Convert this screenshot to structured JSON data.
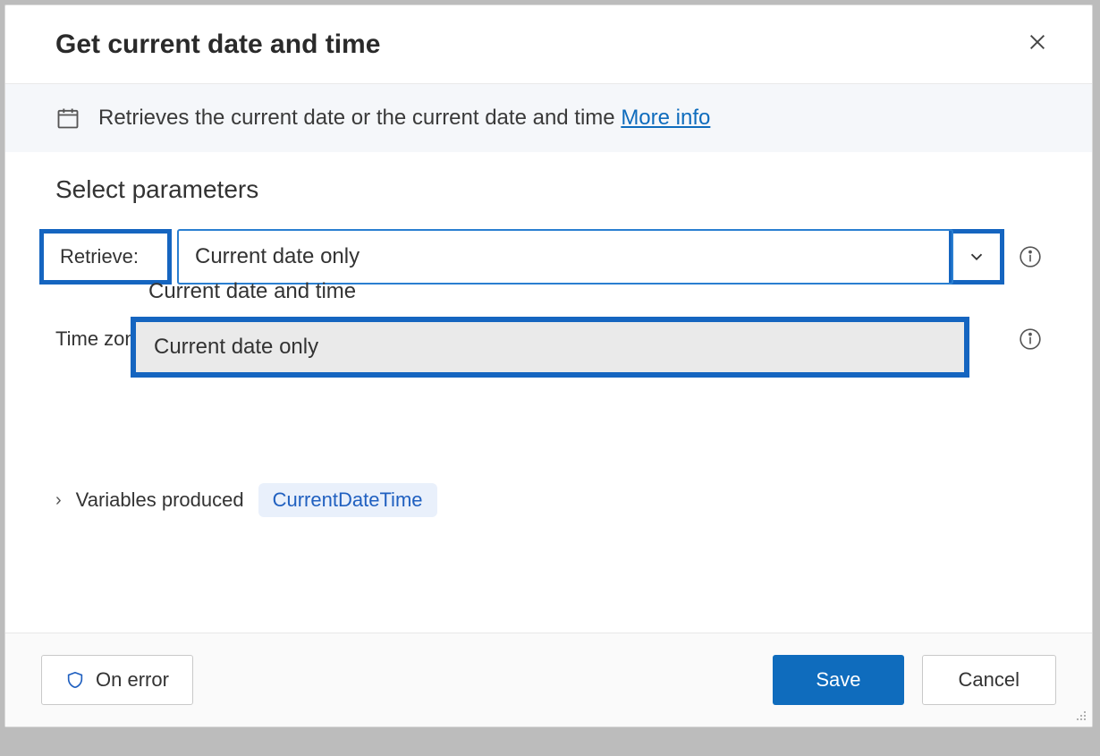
{
  "dialog": {
    "title": "Get current date and time",
    "close_aria": "Close"
  },
  "description": {
    "text": "Retrieves the current date or the current date and time ",
    "more_info": "More info"
  },
  "section": "Select parameters",
  "params": {
    "retrieve_label": "Retrieve:",
    "retrieve_value": "Current date only",
    "retrieve_options": {
      "opt1": "Current date and time",
      "opt2": "Current date only"
    },
    "timezone_label": "Time zone:"
  },
  "variables": {
    "label": "Variables produced",
    "badge": "CurrentDateTime"
  },
  "footer": {
    "on_error": "On error",
    "save": "Save",
    "cancel": "Cancel"
  }
}
